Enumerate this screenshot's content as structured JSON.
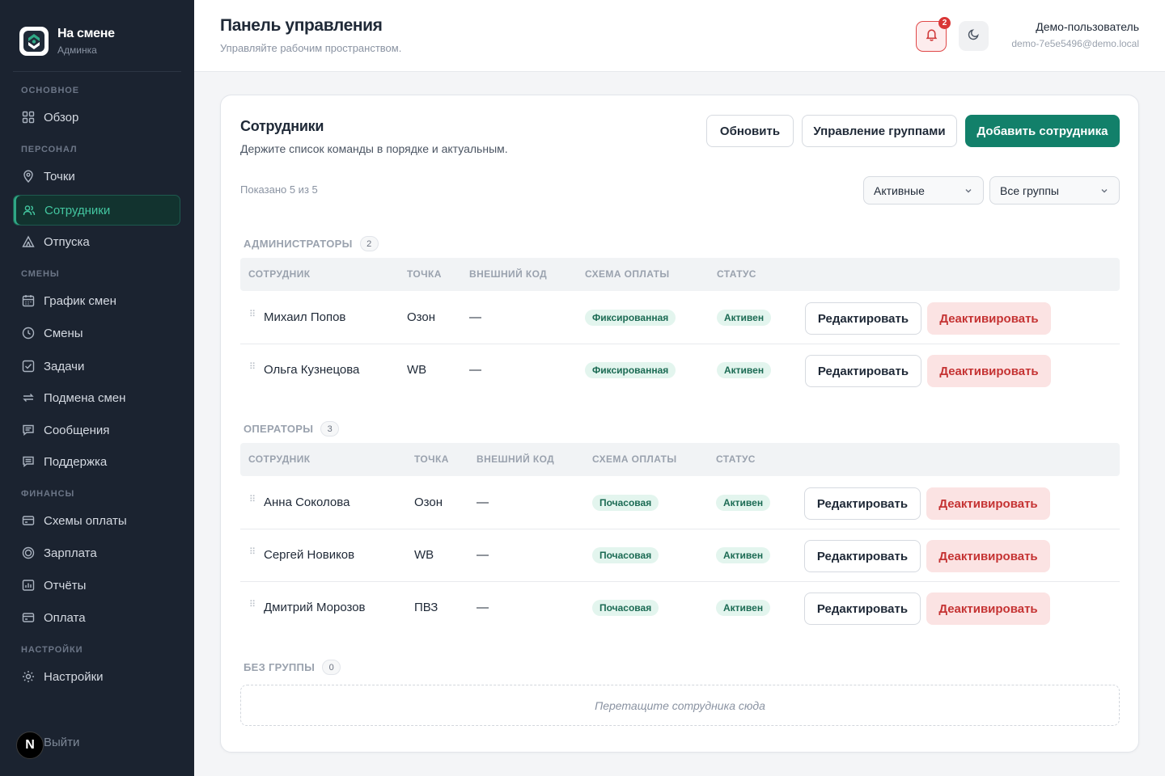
{
  "brand": {
    "name": "На смене",
    "subtitle": "Админка",
    "logo_icon": "app-logo-icon"
  },
  "sidebar": {
    "sections": {
      "main": "ОСНОВНОЕ",
      "staff": "ПЕРСОНАЛ",
      "shifts": "СМЕНЫ",
      "finance": "ФИНАНСЫ",
      "settings": "НАСТРОЙКИ"
    },
    "items": {
      "overview": {
        "label": "Обзор",
        "icon": "grid-icon"
      },
      "points": {
        "label": "Точки",
        "icon": "map-pin-icon"
      },
      "employees": {
        "label": "Сотрудники",
        "icon": "users-icon",
        "active": true
      },
      "vacations": {
        "label": "Отпуска",
        "icon": "tent-icon"
      },
      "schedule": {
        "label": "График смен",
        "icon": "calendar-icon"
      },
      "shifts": {
        "label": "Смены",
        "icon": "clock-icon"
      },
      "tasks": {
        "label": "Задачи",
        "icon": "checkbox-icon"
      },
      "swap": {
        "label": "Подмена смен",
        "icon": "swap-arrows-icon"
      },
      "messages": {
        "label": "Сообщения",
        "icon": "message-icon"
      },
      "support": {
        "label": "Поддержка",
        "icon": "support-chat-icon"
      },
      "pay_schemes": {
        "label": "Схемы оплаты",
        "icon": "wallet-card-icon"
      },
      "salary": {
        "label": "Зарплата",
        "icon": "coin-icon"
      },
      "reports": {
        "label": "Отчёты",
        "icon": "bar-chart-icon"
      },
      "payment": {
        "label": "Оплата",
        "icon": "credit-card-icon"
      },
      "settings": {
        "label": "Настройки",
        "icon": "sun-gear-icon"
      }
    },
    "logout": "Выйти",
    "badge_letter": "N"
  },
  "header": {
    "title": "Панель управления",
    "subtitle": "Управляйте рабочим пространством.",
    "notifications_count": "2",
    "user_name": "Демо-пользователь",
    "user_email": "demo-7e5e5496@demo.local"
  },
  "card": {
    "title": "Сотрудники",
    "subtitle": "Держите список команды в порядке и актуальным.",
    "buttons": {
      "refresh": "Обновить",
      "manage_groups": "Управление группами",
      "add_employee": "Добавить сотрудника"
    },
    "shown_text": "Показано 5 из 5",
    "filters": {
      "status": "Активные",
      "group": "Все группы"
    },
    "columns": {
      "employee": "СОТРУДНИК",
      "point": "ТОЧКА",
      "external_code": "ВНЕШНИЙ КОД",
      "pay_scheme": "СХЕМА ОПЛАТЫ",
      "status": "СТАТУС"
    },
    "row_actions": {
      "edit": "Редактировать",
      "deactivate": "Деактивировать"
    },
    "groups": [
      {
        "name": "АДМИНИСТРАТОРЫ",
        "count": "2",
        "rows": [
          {
            "name": "Михаил Попов",
            "point": "Озон",
            "code": "—",
            "scheme": "Фиксированная",
            "status": "Активен"
          },
          {
            "name": "Ольга Кузнецова",
            "point": "WB",
            "code": "—",
            "scheme": "Фиксированная",
            "status": "Активен"
          }
        ]
      },
      {
        "name": "ОПЕРАТОРЫ",
        "count": "3",
        "rows": [
          {
            "name": "Анна Соколова",
            "point": "Озон",
            "code": "—",
            "scheme": "Почасовая",
            "status": "Активен"
          },
          {
            "name": "Сергей Новиков",
            "point": "WB",
            "code": "—",
            "scheme": "Почасовая",
            "status": "Активен"
          },
          {
            "name": "Дмитрий Морозов",
            "point": "ПВЗ",
            "code": "—",
            "scheme": "Почасовая",
            "status": "Активен"
          }
        ]
      },
      {
        "name": "БЕЗ ГРУППЫ",
        "count": "0",
        "dropzone_text": "Перетащите сотрудника сюда"
      }
    ]
  },
  "colors": {
    "sidebar_bg": "#1b2330",
    "accent": "#12806a",
    "active_nav_text": "#43c6a0",
    "danger": "#c53333",
    "pill_bg": "#e3f5ee"
  }
}
